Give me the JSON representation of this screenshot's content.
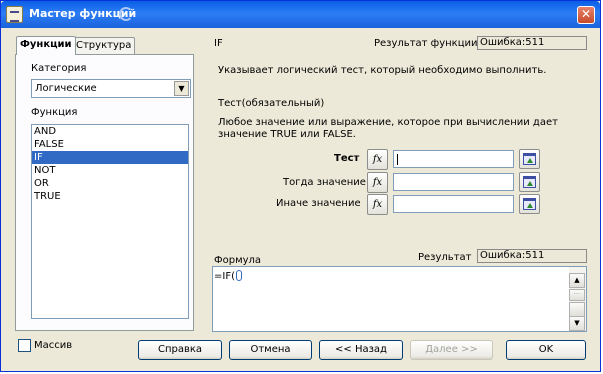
{
  "window": {
    "title": "Мастер функций",
    "close_symbol": "✕"
  },
  "tabs": [
    {
      "label": "Функции",
      "active": true
    },
    {
      "label": "Структура",
      "active": false
    }
  ],
  "left": {
    "category_label": "Категория",
    "category_value": "Логические",
    "function_label": "Функция",
    "functions": [
      "AND",
      "FALSE",
      "IF",
      "NOT",
      "OR",
      "TRUE"
    ],
    "selected_function": "IF"
  },
  "right": {
    "function_name": "IF",
    "result_label": "Результат функции",
    "result_value": "Ошибка:511",
    "description": "Указывает логический тест, который необходимо выполнить.",
    "param_title": "Тест(обязательный)",
    "param_desc_line1": "Любое значение или выражение, которое при вычислении дает",
    "param_desc_line2": "значение TRUE  или FALSE.",
    "args": [
      {
        "label": "Тест",
        "bold": true,
        "value": ""
      },
      {
        "label": "Тогда значение",
        "bold": false,
        "value": ""
      },
      {
        "label": "Иначе значение",
        "bold": false,
        "value": ""
      }
    ],
    "fx_label": "fx",
    "formula_label": "Формула",
    "formula_result_label": "Результат",
    "formula_result_value": "Ошибка:511",
    "formula_text": "=IF("
  },
  "bottom": {
    "array_label": "Массив",
    "array_checked": false,
    "help_button": "Справка",
    "cancel_button": "Отмена",
    "back_button": "<< Назад",
    "next_button": "Далее >>",
    "ok_button": "OK"
  }
}
